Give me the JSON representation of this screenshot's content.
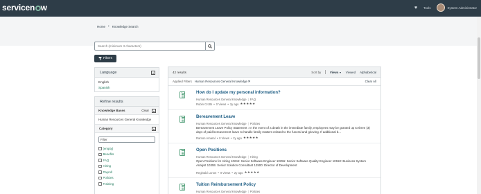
{
  "header": {
    "logo_text": "servicenow",
    "tools_label": "Tools",
    "user_name": "System Administrator",
    "icons": [
      "heart-icon",
      "avatar"
    ]
  },
  "breadcrumb": {
    "home": "Home",
    "current": "Knowledge Search"
  },
  "search": {
    "placeholder": "Search (minimum 3 characters)"
  },
  "filters_button": "Filters",
  "language_panel": {
    "title": "Language",
    "options": [
      "English",
      "Spanish"
    ]
  },
  "refine_panel": {
    "title": "Refine results",
    "knowledge_bases": {
      "label": "Knowledge Bases",
      "clear_label": "Clear",
      "selected": "Human Resources General Knowledge"
    },
    "category": {
      "label": "Category",
      "filter_placeholder": "Filter",
      "items": [
        "(empty)",
        "Benefits",
        "FAQ",
        "Hiring",
        "Payroll",
        "Policies",
        "Training"
      ]
    }
  },
  "results": {
    "count_label": "42 results",
    "sort_by_label": "Sort by",
    "sort_options": [
      "Views",
      "Viewed",
      "Alphabetical"
    ],
    "applied_filters_label": "Applied Filters",
    "applied_filter": "Human Resources General Knowledge",
    "clear_all_label": "Clear All",
    "articles": [
      {
        "title": "How do I update my personal information?",
        "kb": "Human Resources General Knowledge",
        "category": "FAQ",
        "description": "",
        "author": "Rubin Crotts",
        "views": "0 Views",
        "age": "2y ago"
      },
      {
        "title": "Bereavement Leave",
        "kb": "Human Resources General Knowledge",
        "category": "Policies",
        "description": "Bereavement Leave Policy Statement : In the event of a death in the immediate family, employees may be granted up to three (3) days of paid bereavement leave to handle family matters related to the funeral and grieving. If additional b...",
        "author": "Ramon Amaral",
        "views": "0 Views",
        "age": "2y ago"
      },
      {
        "title": "Open Positions",
        "kb": "Human Resources General Knowledge",
        "category": "Hiring",
        "description": "Open Positions for Hiring 10244: Senior Software Engineer 10256: Senior Software Quality Engineer 10150: Business System Analyst 10355: Senior Solution Consultant 12500: Director of Development",
        "author": "Reginald Lunon",
        "views": "0 Views",
        "age": "2y ago"
      },
      {
        "title": "Tuition Reimbursement Policy",
        "kb": "Human Resources General Knowledge",
        "category": "Policies",
        "description": "",
        "author": "",
        "views": "",
        "age": ""
      }
    ]
  }
}
